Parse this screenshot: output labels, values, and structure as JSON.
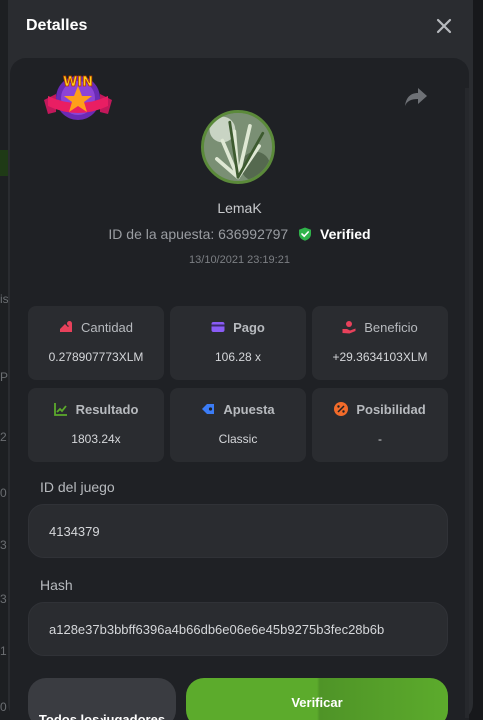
{
  "background_page": {
    "edge_chars": [
      "is",
      "P",
      "2",
      "0",
      "3",
      "3",
      "1",
      "3",
      "0"
    ]
  },
  "modal": {
    "title": "Detalles",
    "close_icon": "close-icon"
  },
  "bet": {
    "badge_text": "WIN",
    "share_icon": "share-icon",
    "username": "LemaK",
    "bet_id_label": "ID de la apuesta:",
    "bet_id": "636992797",
    "verified_label": "Verified",
    "timestamp": "13/10/2021 23:19:21"
  },
  "stats": [
    {
      "label": "Cantidad",
      "value": "0.278907773XLM",
      "icon": "coins-icon",
      "color": "#e8415b",
      "bold": false
    },
    {
      "label": "Pago",
      "value": "106.28 x",
      "icon": "card-icon",
      "color": "#8a5cf6",
      "bold": true
    },
    {
      "label": "Beneficio",
      "value": "+29.3634103XLM",
      "icon": "hand-coin-icon",
      "color": "#e8415b",
      "bold": false
    },
    {
      "label": "Resultado",
      "value": "1803.24x",
      "icon": "chart-icon",
      "color": "#5cab2c",
      "bold": true
    },
    {
      "label": "Apuesta",
      "value": "Classic",
      "icon": "tag-icon",
      "color": "#3b7cf6",
      "bold": true
    },
    {
      "label": "Posibilidad",
      "value": "-",
      "icon": "percent-icon",
      "color": "#f26b2a",
      "bold": true
    }
  ],
  "game_id": {
    "label": "ID del juego",
    "value": "4134379"
  },
  "hash": {
    "label": "Hash",
    "value": "a128e37b3bbff6396a4b66db6e06e6e45b9275b3fec28b6b"
  },
  "buttons": {
    "all_players": "Todos los jugadores",
    "all_players_chevron": "›",
    "verify": "Verificar"
  },
  "colors": {
    "accent_green": "#5cab2c",
    "verified_green": "#2fb34a"
  }
}
